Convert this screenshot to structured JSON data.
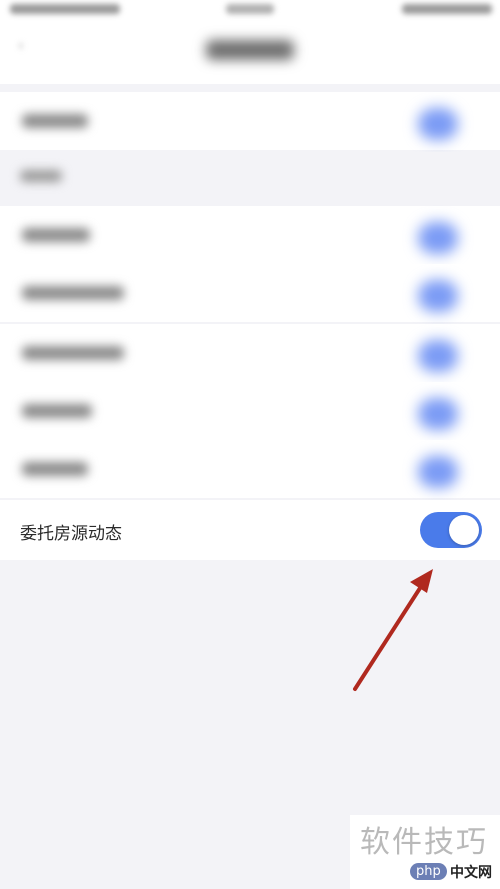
{
  "settings": {
    "visible_row": {
      "label": "委托房源动态",
      "enabled": true
    }
  },
  "watermark": {
    "text": "软件技巧",
    "logo": "php",
    "site": "中文网"
  },
  "colors": {
    "toggle_on": "#4a7bea",
    "annotation_arrow": "#b0291f",
    "background": "#f3f3f7"
  }
}
